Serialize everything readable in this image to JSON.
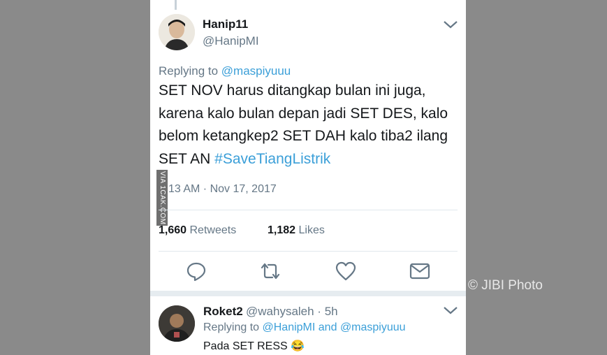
{
  "tweet": {
    "display_name": "Hanip11",
    "handle": "@HanipMI",
    "replying_label": "Replying to",
    "replying_to": "@maspiyuuu",
    "text_plain": "SET NOV harus ditangkap bulan ini juga, karena kalo bulan depan jadi SET DES, kalo belom ketangkep2 SET DAH kalo tiba2 ilang SET AN",
    "hashtag": "#SaveTiangListrik",
    "timestamp": "13 AM · Nov 17, 2017",
    "retweets_count": "1,660",
    "retweets_label": "Retweets",
    "likes_count": "1,182",
    "likes_label": "Likes"
  },
  "actions": [
    "reply-icon",
    "retweet-icon",
    "like-icon",
    "message-icon"
  ],
  "reply": {
    "display_name": "Roket2",
    "handle_time": "@wahysaleh · 5h",
    "replying_label": "Replying to",
    "replying_to_1": "@HanipMI",
    "and_label": "and",
    "replying_to_2": "@maspiyuuu",
    "text": "Pada SET RESS",
    "emoji": "😂"
  },
  "watermarks": {
    "side": "VIA 1CAK.COM",
    "corner": "© JIBI Photo"
  },
  "colors": {
    "link": "#3b9fd8",
    "muted": "#657786",
    "text": "#14171a"
  }
}
